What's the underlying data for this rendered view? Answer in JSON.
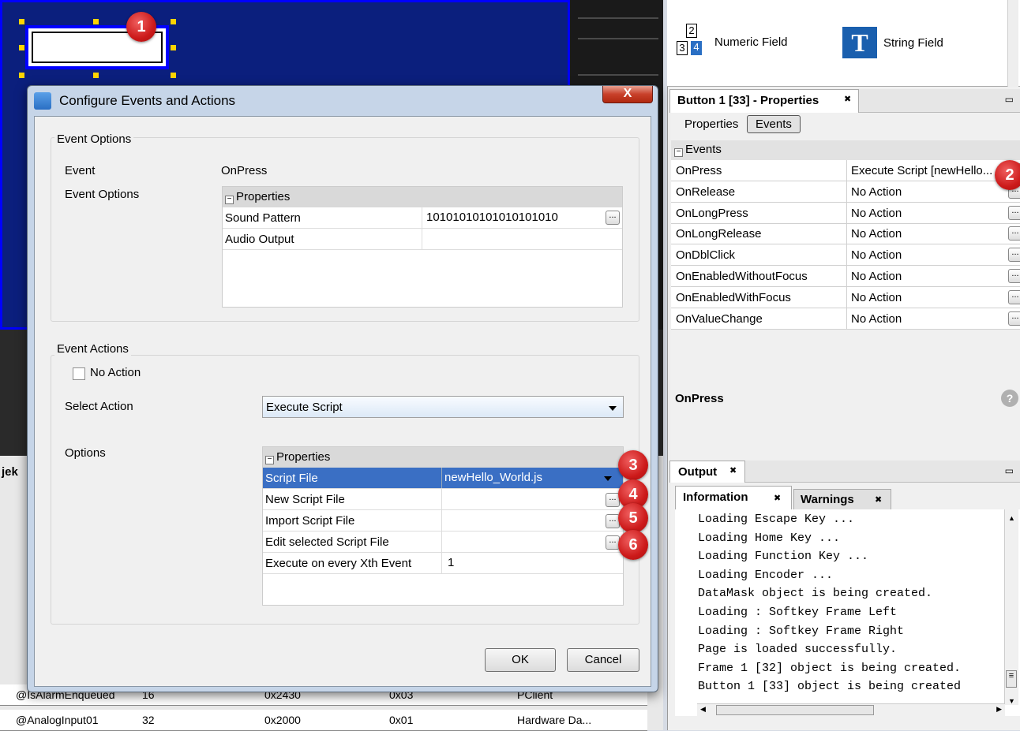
{
  "palette": {
    "numeric_field": "Numeric Field",
    "string_field": "String Field",
    "numeric_icon_top": "2",
    "numeric_icon_b1": "3",
    "numeric_icon_b2": "4",
    "string_icon": "T"
  },
  "badges": [
    "1",
    "2",
    "3",
    "4",
    "5",
    "6"
  ],
  "properties_panel": {
    "title": "Button 1 [33] - Properties",
    "tab_properties": "Properties",
    "tab_events": "Events",
    "section": "Events",
    "rows": [
      {
        "name": "OnPress",
        "value": "Execute Script [newHello..."
      },
      {
        "name": "OnRelease",
        "value": "No Action"
      },
      {
        "name": "OnLongPress",
        "value": "No Action"
      },
      {
        "name": "OnLongRelease",
        "value": "No Action"
      },
      {
        "name": "OnDblClick",
        "value": "No Action"
      },
      {
        "name": "OnEnabledWithoutFocus",
        "value": "No Action"
      },
      {
        "name": "OnEnabledWithFocus",
        "value": "No Action"
      },
      {
        "name": "OnValueChange",
        "value": "No Action"
      }
    ],
    "description_title": "OnPress"
  },
  "output_panel": {
    "title": "Output",
    "tab_information": "Information",
    "tab_warnings": "Warnings",
    "lines": [
      "Loading Escape Key ...",
      "Loading Home Key ...",
      "Loading Function Key ...",
      "Loading Encoder ...",
      "DataMask object is being created.",
      "Loading : Softkey Frame Left",
      "Loading : Softkey Frame Right",
      "Page is loaded successfully.",
      "Frame 1 [32] object is being created.",
      "Button 1 [33] object is being created"
    ]
  },
  "background_table": {
    "side_label": "jek",
    "rows": [
      {
        "c1": "@IsAlarmEnqueued",
        "c2": "16",
        "c3": "0x2430",
        "c4": "0x03",
        "c5": "PClient"
      },
      {
        "c1": "@AnalogInput01",
        "c2": "32",
        "c3": "0x2000",
        "c4": "0x01",
        "c5": "Hardware Da..."
      }
    ]
  },
  "dialog": {
    "title": "Configure Events and Actions",
    "close": "X",
    "event_options_group": "Event Options",
    "event_label": "Event",
    "event_value": "OnPress",
    "event_options_label": "Event Options",
    "props_header": "Properties",
    "event_props": [
      {
        "name": "Sound Pattern",
        "value": "10101010101010101010"
      },
      {
        "name": "Audio Output",
        "value": ""
      }
    ],
    "event_actions_group": "Event Actions",
    "no_action_label": "No Action",
    "select_action_label": "Select Action",
    "select_action_value": "Execute Script",
    "options_label": "Options",
    "options_props": [
      {
        "name": "Script File",
        "value": "newHello_World.js"
      },
      {
        "name": "New Script File",
        "value": ""
      },
      {
        "name": "Import Script File",
        "value": ""
      },
      {
        "name": "Edit selected Script File",
        "value": ""
      },
      {
        "name": "Execute on every Xth Event",
        "value": "1"
      }
    ],
    "ok": "OK",
    "cancel": "Cancel"
  },
  "colors": {
    "canvas": "#0b1f7d",
    "selection": "#0000ff",
    "selected_row": "#3a6fc4",
    "badge": "#cc1a1a",
    "handle": "#ffd400"
  }
}
